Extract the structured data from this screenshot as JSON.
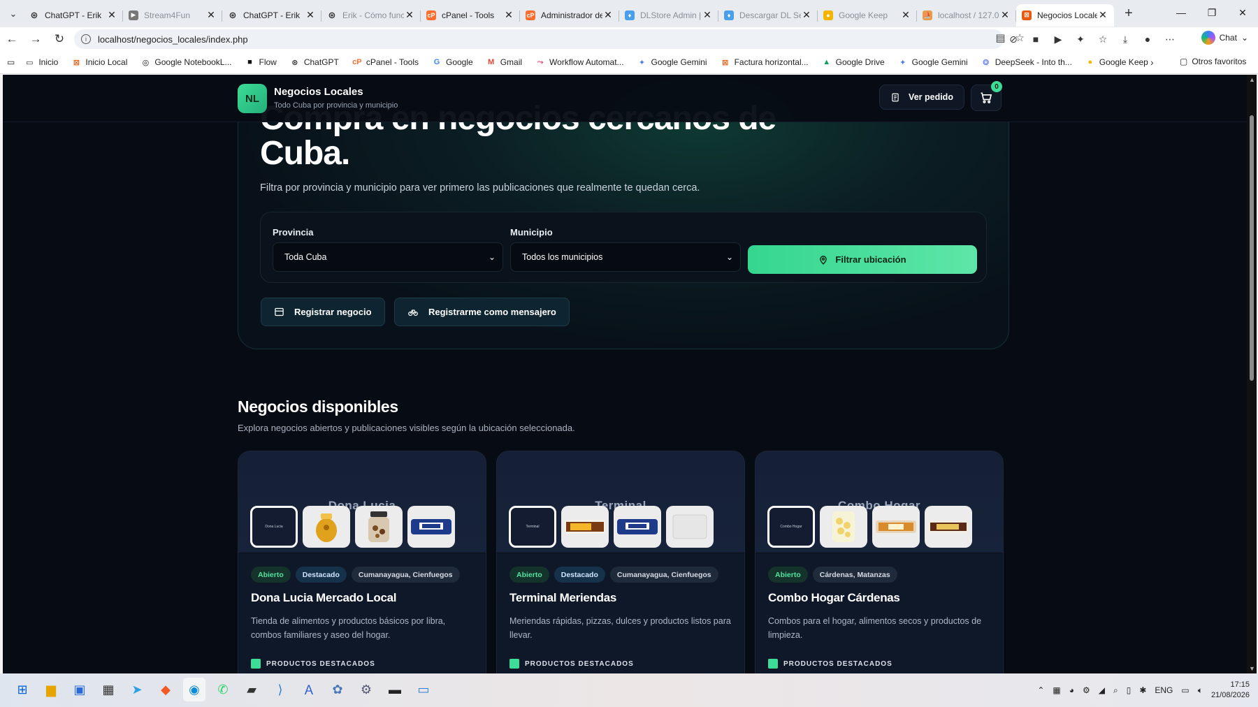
{
  "browser": {
    "tabs": [
      {
        "title": "ChatGPT - Erik",
        "icon": "chatgpt-icon",
        "dim": false
      },
      {
        "title": "Stream4Fun",
        "icon": "play-icon",
        "dim": true
      },
      {
        "title": "ChatGPT - Erik",
        "icon": "chatgpt-icon",
        "dim": false
      },
      {
        "title": "Erik - Cómo func",
        "icon": "chatgpt-icon",
        "dim": true
      },
      {
        "title": "cPanel - Tools",
        "icon": "cpanel-icon",
        "dim": false
      },
      {
        "title": "Administrador de",
        "icon": "cpanel-icon",
        "dim": false
      },
      {
        "title": "DLStore Admin | (",
        "icon": "pin-icon",
        "dim": true
      },
      {
        "title": "Descargar DL Ser",
        "icon": "pin-icon",
        "dim": true
      },
      {
        "title": "Google Keep",
        "icon": "keep-icon",
        "dim": true
      },
      {
        "title": "localhost / 127.0.",
        "icon": "phpmyadmin-icon",
        "dim": true
      }
    ],
    "active_tab": {
      "title": "Negocios Locales",
      "icon": "site-icon"
    },
    "url": "localhost/negocios_locales/index.php",
    "chat_label": "Chat",
    "bookmarks": [
      {
        "label": "Inicio",
        "icon": "page-icon",
        "color": "#333333"
      },
      {
        "label": "Inicio Local",
        "icon": "site-icon",
        "color": "#e8590c"
      },
      {
        "label": "Google NotebookL...",
        "icon": "notebook-icon",
        "color": "#111111"
      },
      {
        "label": "Flow",
        "icon": "folder-icon",
        "color": "#111111"
      },
      {
        "label": "ChatGPT",
        "icon": "chatgpt-icon",
        "color": "#333333"
      },
      {
        "label": "cPanel - Tools",
        "icon": "cpanel-icon",
        "color": "#ff6c2c"
      },
      {
        "label": "Google",
        "icon": "google-icon",
        "color": "#4285f4"
      },
      {
        "label": "Gmail",
        "icon": "gmail-icon",
        "color": "#ea4335"
      },
      {
        "label": "Workflow Automat...",
        "icon": "workflow-icon",
        "color": "#ea4b71"
      },
      {
        "label": "Google Gemini",
        "icon": "gemini-icon",
        "color": "#4b7bec"
      },
      {
        "label": "Factura horizontal...",
        "icon": "site-icon",
        "color": "#e8590c"
      },
      {
        "label": "Google Drive",
        "icon": "drive-icon",
        "color": "#0f9d58"
      },
      {
        "label": "Google Gemini",
        "icon": "gemini-icon",
        "color": "#4b7bec"
      },
      {
        "label": "DeepSeek - Into th...",
        "icon": "deepseek-icon",
        "color": "#4d6bfe"
      },
      {
        "label": "Google Keep",
        "icon": "keep-icon",
        "color": "#f4b400"
      }
    ],
    "other_bookmarks": "Otros favoritos"
  },
  "site": {
    "logo_initials": "NL",
    "brand_name": "Negocios Locales",
    "brand_sub": "Todo Cuba por provincia y municipio",
    "ver_pedido": "Ver pedido",
    "cart_count": "0"
  },
  "hero": {
    "title": "Compra en negocios cercanos de Cuba.",
    "description": "Filtra por provincia y municipio para ver primero las publicaciones que realmente te quedan cerca.",
    "provincia_label": "Provincia",
    "provincia_value": "Toda Cuba",
    "municipio_label": "Municipio",
    "municipio_value": "Todos los municipios",
    "filter_button": "Filtrar ubicación",
    "register_business": "Registrar negocio",
    "register_courier": "Registrarme como mensajero"
  },
  "section": {
    "title": "Negocios disponibles",
    "subtitle": "Explora negocios abiertos y publicaciones visibles según la ubicación seleccionada."
  },
  "cards": [
    {
      "cover_label": "Dona Lucia",
      "badges": [
        "Abierto",
        "Destacado",
        "Cumanayagua, Cienfuegos"
      ],
      "name": "Dona Lucia Mercado Local",
      "description": "Tienda de alimentos y productos básicos por libra, combos familiares y aseo del hogar.",
      "products_label": "PRODUCTOS DESTACADOS",
      "thumbs": [
        "honey-jar",
        "nuts-jar",
        "cookie-pack"
      ]
    },
    {
      "cover_label": "Terminal",
      "badges": [
        "Abierto",
        "Destacado",
        "Cumanayagua, Cienfuegos"
      ],
      "name": "Terminal Meriendas",
      "description": "Meriendas rápidas, pizzas, dulces y productos listos para llevar.",
      "products_label": "PRODUCTOS DESTACADOS",
      "thumbs": [
        "snack-bar",
        "cookie-pack",
        "white-box"
      ]
    },
    {
      "cover_label": "Combo Hogar",
      "badges": [
        "Abierto",
        "Cárdenas, Matanzas"
      ],
      "name": "Combo Hogar Cárdenas",
      "description": "Combos para el hogar, alimentos secos y productos de limpieza.",
      "products_label": "PRODUCTOS DESTACADOS",
      "thumbs": [
        "popcorn-bag",
        "wafer-bar",
        "chocolate-bar"
      ]
    }
  ],
  "taskbar": {
    "lang": "ENG",
    "time": "17:15",
    "date": "21/08/2026"
  }
}
